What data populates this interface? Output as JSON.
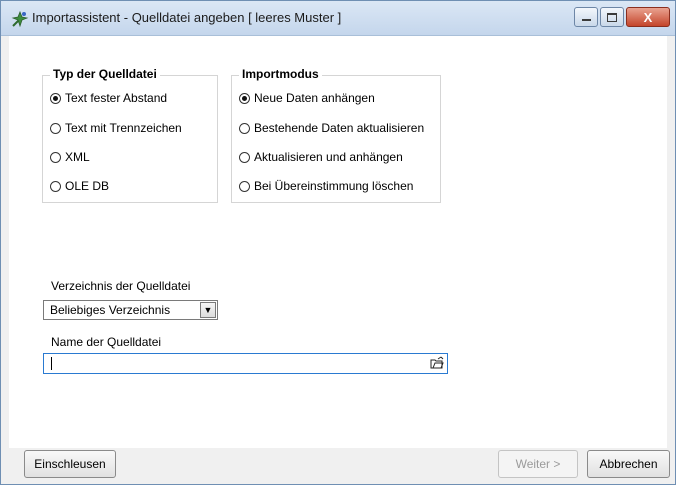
{
  "window": {
    "title": "Importassistent - Quelldatei angeben [ leeres Muster ]",
    "controls": {
      "minimize": "–",
      "maximize": "□",
      "close": "X"
    }
  },
  "source_type": {
    "title": "Typ der Quelldatei",
    "options": [
      "Text fester Abstand",
      "Text mit Trennzeichen",
      "XML",
      "OLE DB"
    ],
    "selected": "Text fester Abstand"
  },
  "import_mode": {
    "title": "Importmodus",
    "options": [
      "Neue Daten anhängen",
      "Bestehende Daten aktualisieren",
      "Aktualisieren und anhängen",
      "Bei Übereinstimmung löschen"
    ],
    "selected": "Neue Daten anhängen"
  },
  "directory": {
    "label": "Verzeichnis der Quelldatei",
    "value": "Beliebiges Verzeichnis"
  },
  "filename": {
    "label": "Name der Quelldatei",
    "value": ""
  },
  "buttons": {
    "einschleusen": "Einschleusen",
    "weiter": "Weiter >",
    "abbrechen": "Abbrechen"
  }
}
